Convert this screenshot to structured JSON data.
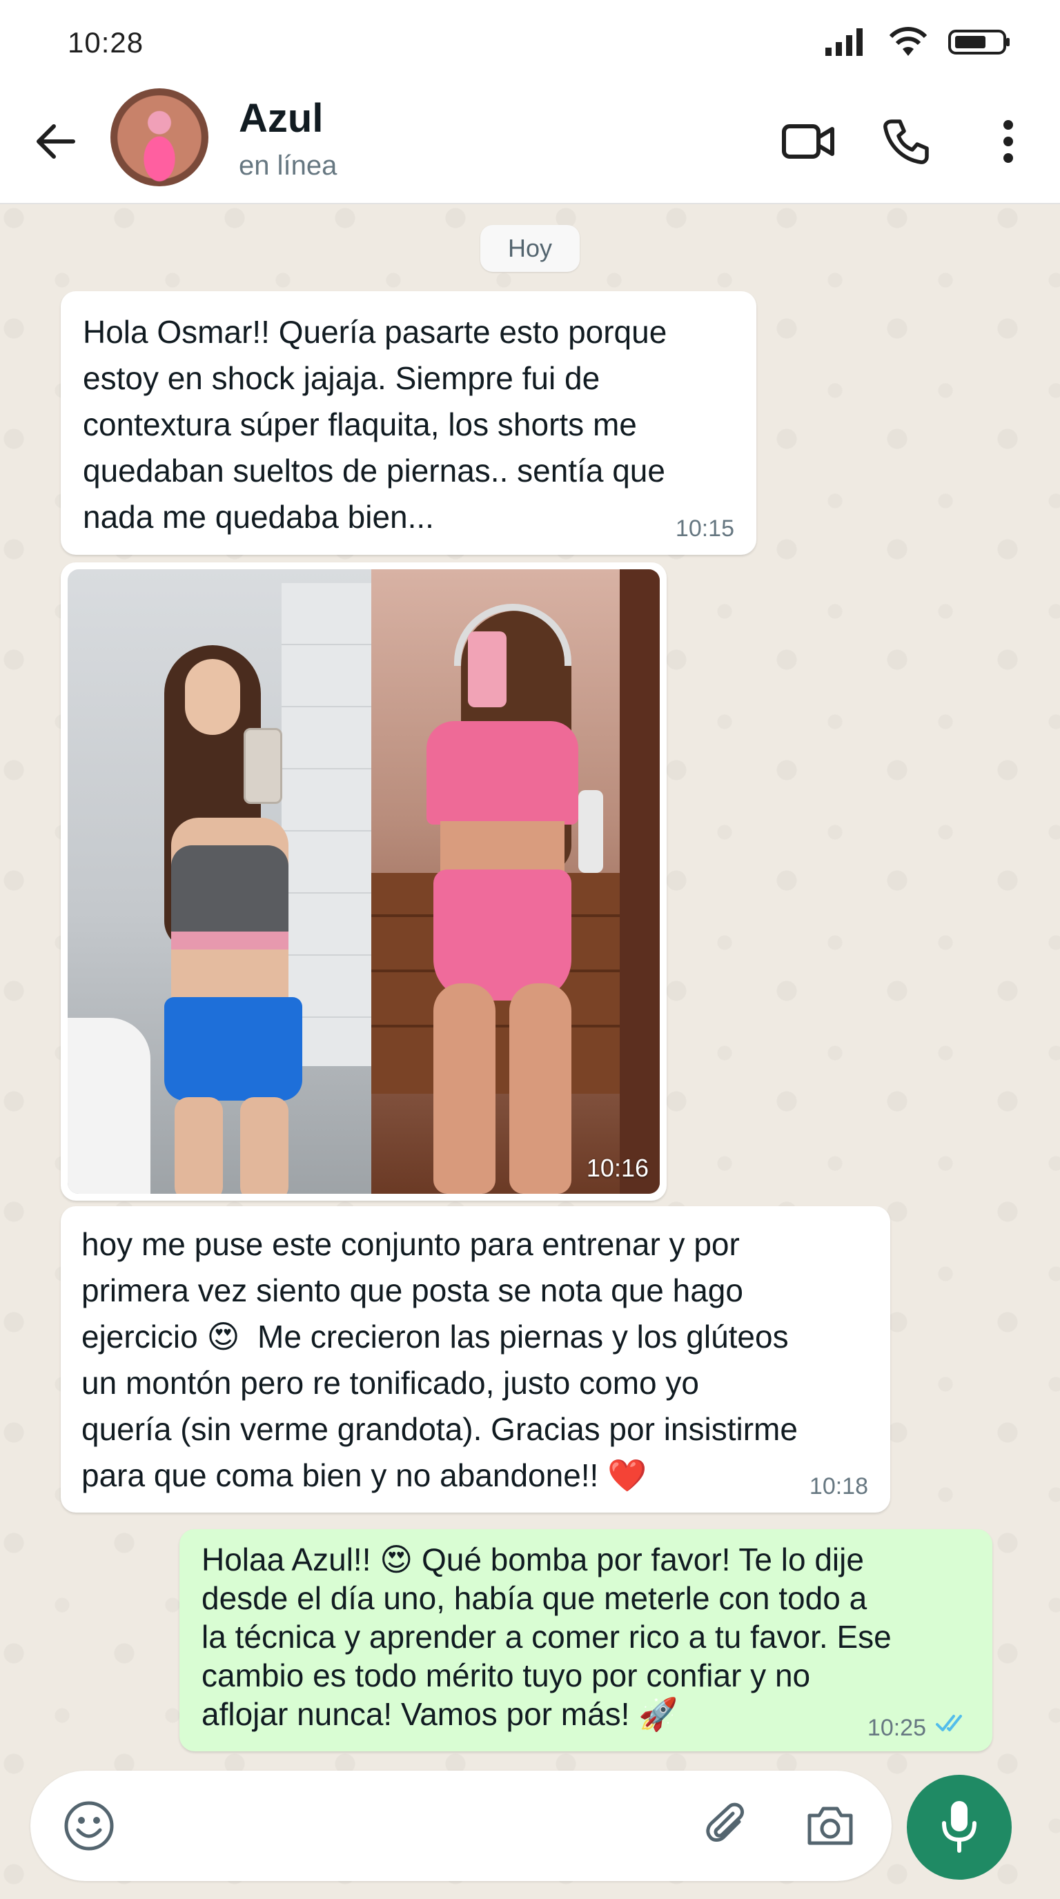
{
  "status_bar": {
    "time": "10:28",
    "icons": [
      "signal-icon",
      "wifi-icon",
      "battery-icon"
    ]
  },
  "header": {
    "contact_name": "Azul",
    "contact_status": "en línea",
    "icons": [
      "back-arrow-icon",
      "video-call-icon",
      "phone-icon",
      "more-vertical-icon"
    ]
  },
  "chat": {
    "date_label": "Hoy",
    "messages": [
      {
        "direction": "in",
        "text": "Hola Osmar!! Quería pasarte esto porque\nestoy en shock jajaja. Siempre fui de\ncontextura súper flaquita, los shorts me\nquedaban sueltos de piernas.. sentía que\nnada me quedaba bien...",
        "time": "10:15"
      },
      {
        "direction": "in",
        "type": "image",
        "time": "10:16"
      },
      {
        "direction": "in",
        "text": "hoy me puse este conjunto para entrenar y por\nprimera vez siento que posta se nota que hago\nejercicio 😍  Me crecieron las piernas y los glúteos\nun montón pero re tonificado, justo como yo\nquería (sin verme grandota). Gracias por insistirme\npara que coma bien y no abandone!! ❤️",
        "time": "10:18"
      },
      {
        "direction": "out",
        "text": "Holaa Azul!! 😍 Qué bomba por favor! Te lo dije\ndesde el día uno, había que meterle con todo a\nla técnica y aprender a comer rico a tu favor. Ese\ncambio es todo mérito tuyo por confiar y no\naflojar nunca! Vamos por más! 🚀",
        "time": "10:25",
        "read_receipt": "double-check-icon"
      }
    ]
  },
  "input_bar": {
    "icons": [
      "emoji-icon",
      "attach-icon",
      "camera-icon",
      "mic-icon"
    ]
  },
  "colors": {
    "chat_background": "#efeae2",
    "incoming_bubble": "#ffffff",
    "outgoing_bubble": "#d9fdd3",
    "mic_button": "#1f8a64",
    "read_check": "#53bdeb"
  }
}
